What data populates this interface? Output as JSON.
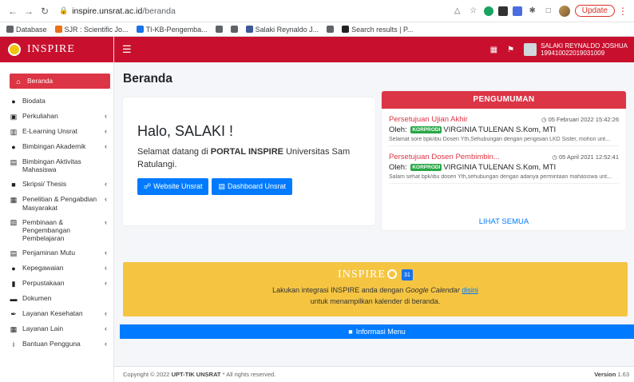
{
  "browser": {
    "url_host": "inspire.unsrat.ac.id",
    "url_path": "/beranda",
    "update_label": "Update",
    "bookmarks": [
      {
        "label": "Database",
        "color": "#5f6368"
      },
      {
        "label": "SJR : Scientific Jo...",
        "color": "#e8711a"
      },
      {
        "label": "TI-KB-Pengemba...",
        "color": "#1a73e8"
      },
      {
        "label": "",
        "color": "#5f6368"
      },
      {
        "label": "",
        "color": "#5f6368"
      },
      {
        "label": "Salaki Reynaldo J...",
        "color": "#3b5998"
      },
      {
        "label": "",
        "color": "#5f6368"
      },
      {
        "label": "Search results | P...",
        "color": "#222222"
      }
    ]
  },
  "brand": {
    "name": "INSPIRE"
  },
  "topbar": {
    "user_name": "SALAKI REYNALDO JOSHUA",
    "user_id": "199410022019031009"
  },
  "sidebar": {
    "items": [
      {
        "label": "Beranda",
        "icon": "home-icon",
        "glyph": "⌂",
        "chevron": false,
        "active": true
      },
      {
        "label": "Biodata",
        "icon": "user-icon",
        "glyph": "●",
        "chevron": false
      },
      {
        "label": "Perkuliahan",
        "icon": "chalkboard-icon",
        "glyph": "▣",
        "chevron": true
      },
      {
        "label": "E-Learning Unsrat",
        "icon": "book-open-icon",
        "glyph": "▥",
        "chevron": true
      },
      {
        "label": "Bimbingan Akademik",
        "icon": "users-icon",
        "glyph": "●",
        "chevron": true
      },
      {
        "label": "Bimbingan Aktivitas Mahasiswa",
        "icon": "building-icon",
        "glyph": "▤",
        "chevron": false
      },
      {
        "label": "Skripsi/ Thesis",
        "icon": "book-icon",
        "glyph": "■",
        "chevron": true
      },
      {
        "label": "Penelitian & Pengabdian Masyarakat",
        "icon": "hands-icon",
        "glyph": "▦",
        "chevron": true
      },
      {
        "label": "Pembinaan & Pengembangan Pembelajaran",
        "icon": "chalkboard-teacher-icon",
        "glyph": "▧",
        "chevron": true
      },
      {
        "label": "Penjaminan Mutu",
        "icon": "chart-icon",
        "glyph": "▤",
        "chevron": true
      },
      {
        "label": "Kepegawaian",
        "icon": "user-tie-icon",
        "glyph": "●",
        "chevron": true
      },
      {
        "label": "Perpustakaan",
        "icon": "bookmark-icon",
        "glyph": "▮",
        "chevron": true
      },
      {
        "label": "Dokumen",
        "icon": "folder-icon",
        "glyph": "▬",
        "chevron": false
      },
      {
        "label": "Layanan Kesehatan",
        "icon": "medkit-icon",
        "glyph": "✒",
        "chevron": true
      },
      {
        "label": "Layanan Lain",
        "icon": "th-icon",
        "glyph": "▦",
        "chevron": true
      },
      {
        "label": "Bantuan Pengguna",
        "icon": "info-icon",
        "glyph": "i",
        "chevron": true
      }
    ]
  },
  "main": {
    "page_title": "Beranda",
    "hello": "Halo, SALAKI !",
    "welcome_pre": "Selamat datang di ",
    "welcome_bold": "PORTAL INSPIRE",
    "welcome_post": " Universitas Sam Ratulangi.",
    "btn_website": "Website Unsrat",
    "btn_dashboard": "Dashboard Unsrat"
  },
  "announcements": {
    "header": "PENGUMUMAN",
    "see_all": "LIHAT SEMUA",
    "items": [
      {
        "title": "Persetujuan Ujian Akhir",
        "date": "05 Februari 2022 15:42:26",
        "by_label": "Oleh:",
        "badge": "KORPRODI",
        "author": "VIRGINIA TULENAN S.Kom, MTI",
        "snippet": "Selamat sore bpk/ibu Dosen Yth,Sehubungan dengan pengisian LKD Sister, mohon unt..."
      },
      {
        "title": "Persetujuan Dosen Pembimbin...",
        "date": "05 April 2021 12:52:41",
        "by_label": "Oleh:",
        "badge": "KORPRODI",
        "author": "VIRGINIA TULENAN S.Kom, MTI",
        "snippet": "Salam sehat bpk/ibu dosen Yth,sehubungan dengan adanya permintaan mahasiswa unt..."
      }
    ]
  },
  "gcal": {
    "brand": "INSPIRE",
    "calendar_day": "31",
    "text_pre": "Lakukan integrasi INSPIRE anda dengan ",
    "text_italic": "Google Calendar",
    "text_link": "disini",
    "text_line2": "untuk menampilkan kalender di beranda."
  },
  "info_menu": {
    "label": "Informasi Menu"
  },
  "footer": {
    "copyright_pre": "Copyright © 2022 ",
    "copyright_bold": "UPT-TIK UNSRAT",
    "copyright_post": " * All rights reserved.",
    "version_label": "Version",
    "version": "1.63"
  }
}
